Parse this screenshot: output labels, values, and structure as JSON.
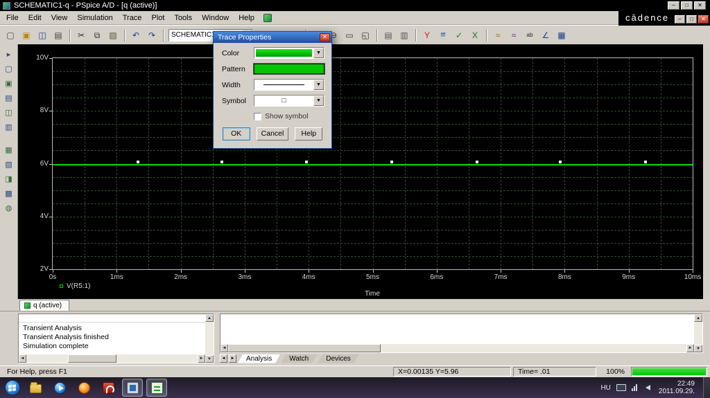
{
  "window": {
    "title": "SCHEMATIC1-q - PSpice A/D - [q (active)]",
    "brand": "cādence",
    "controls": {
      "minimize": "–",
      "maximize": "□",
      "close": "✕"
    }
  },
  "ui": {
    "dropdown_arrow": "▼",
    "up_arrow": "▲",
    "down_arrow": "▼",
    "left_arrow": "◄",
    "right_arrow": "►"
  },
  "menu": {
    "items": [
      "File",
      "Edit",
      "View",
      "Simulation",
      "Trace",
      "Plot",
      "Tools",
      "Window",
      "Help"
    ]
  },
  "toolbar": {
    "profile_value": "SCHEMATIC1-q",
    "icons": [
      {
        "name": "new-file",
        "glyph": "▢",
        "color": "#444444"
      },
      {
        "name": "open-file",
        "glyph": "▣",
        "color": "#b8860b"
      },
      {
        "name": "save-file",
        "glyph": "◫",
        "color": "#1d3f8f"
      },
      {
        "name": "print",
        "glyph": "▤",
        "color": "#444444"
      },
      {
        "sep": true
      },
      {
        "name": "cut",
        "glyph": "✂",
        "color": "#333333"
      },
      {
        "name": "copy",
        "glyph": "⧉",
        "color": "#333333"
      },
      {
        "name": "paste",
        "glyph": "▨",
        "color": "#555533"
      },
      {
        "sep": true
      },
      {
        "name": "undo",
        "glyph": "↶",
        "color": "#1d3f8f"
      },
      {
        "name": "redo",
        "glyph": "↷",
        "color": "#1d3f8f"
      },
      {
        "sep": true
      },
      {
        "combo": true
      },
      {
        "name": "run-simulation",
        "glyph": "▶",
        "color": "#1d6fbf"
      },
      {
        "name": "pause-simulation",
        "glyph": "‖",
        "color": "#222222"
      },
      {
        "name": "stop-simulation",
        "glyph": "■",
        "color": "#aa2222"
      },
      {
        "sep": true
      },
      {
        "name": "zoom-in",
        "glyph": "⊕",
        "color": "#333333"
      },
      {
        "name": "zoom-out",
        "glyph": "⊖",
        "color": "#333333"
      },
      {
        "name": "zoom-area",
        "glyph": "▭",
        "color": "#333333"
      },
      {
        "name": "zoom-fit",
        "glyph": "◱",
        "color": "#333333"
      },
      {
        "sep": true
      },
      {
        "name": "log-x-axis",
        "glyph": "▤",
        "color": "#555555"
      },
      {
        "name": "log-y-axis",
        "glyph": "▥",
        "color": "#555555"
      },
      {
        "sep": true
      },
      {
        "name": "toggle-cursor",
        "glyph": "Y",
        "color": "#c02020"
      },
      {
        "name": "fourier",
        "glyph": "fff",
        "color": "#1d3f8f",
        "small": true
      },
      {
        "name": "evaluate-measurement",
        "glyph": "✓",
        "color": "#0a8a0a"
      },
      {
        "name": "export-to-excel",
        "glyph": "X",
        "color": "#0a7a2a"
      },
      {
        "sep": true
      },
      {
        "name": "mark-data-points",
        "glyph": "≈",
        "color": "#a06000"
      },
      {
        "name": "performance-analysis",
        "glyph": "≈",
        "color": "#6020a0"
      },
      {
        "name": "text-label",
        "glyph": "ab",
        "color": "#222222",
        "small": true
      },
      {
        "name": "plot-waveform",
        "glyph": "∠",
        "color": "#1d3f8f"
      },
      {
        "name": "copy-to-clipboard",
        "glyph": "▦",
        "color": "#1d3f8f"
      }
    ]
  },
  "sidebar": {
    "icons": [
      {
        "name": "sidebar-tool-1",
        "glyph": "▸",
        "color": "#2a4a7a"
      },
      {
        "name": "sidebar-tool-2",
        "glyph": "▢",
        "color": "#2a4a7a"
      },
      {
        "name": "sidebar-tool-3",
        "glyph": "▣",
        "color": "#3a6a3a"
      },
      {
        "name": "sidebar-tool-4",
        "glyph": "▤",
        "color": "#2a4a7a"
      },
      {
        "name": "sidebar-tool-5",
        "glyph": "◫",
        "color": "#3a6a3a"
      },
      {
        "name": "sidebar-tool-6",
        "glyph": "▥",
        "color": "#2a4a7a"
      },
      {
        "gap": true
      },
      {
        "name": "sidebar-tool-7",
        "glyph": "▦",
        "color": "#3a6a3a"
      },
      {
        "name": "sidebar-tool-8",
        "glyph": "▧",
        "color": "#2a4a7a"
      },
      {
        "name": "sidebar-tool-9",
        "glyph": "◨",
        "color": "#3a6a3a"
      },
      {
        "name": "sidebar-tool-10",
        "glyph": "▩",
        "color": "#2a4a7a"
      },
      {
        "name": "sidebar-tool-11",
        "glyph": "◍",
        "color": "#3a6a3a"
      }
    ]
  },
  "chart_data": {
    "type": "line",
    "title": "",
    "xlabel": "Time",
    "ylabel": "",
    "xlim": [
      0,
      10
    ],
    "ylim": [
      2,
      10
    ],
    "x_unit": "ms",
    "grid": true,
    "grid_step_x": 0.5,
    "grid_step_y": 0.5,
    "x_ticks": [
      {
        "v": 0,
        "label": "0s"
      },
      {
        "v": 1,
        "label": "1ms"
      },
      {
        "v": 2,
        "label": "2ms"
      },
      {
        "v": 3,
        "label": "3ms"
      },
      {
        "v": 4,
        "label": "4ms"
      },
      {
        "v": 5,
        "label": "5ms"
      },
      {
        "v": 6,
        "label": "6ms"
      },
      {
        "v": 7,
        "label": "7ms"
      },
      {
        "v": 8,
        "label": "8ms"
      },
      {
        "v": 9,
        "label": "9ms"
      },
      {
        "v": 10,
        "label": "10ms"
      }
    ],
    "y_ticks": [
      {
        "v": 2,
        "label": "2V"
      },
      {
        "v": 4,
        "label": "4V"
      },
      {
        "v": 6,
        "label": "6V"
      },
      {
        "v": 8,
        "label": "8V"
      },
      {
        "v": 10,
        "label": "10V"
      }
    ],
    "series": [
      {
        "name": "V(R5:1)",
        "color": "#00d800",
        "shape": "constant",
        "value": 5.95,
        "marker_x": [
          1.33,
          2.64,
          3.97,
          5.3,
          6.63,
          7.93,
          9.26
        ]
      }
    ],
    "legend_position": "bottom-left",
    "background": "#000000"
  },
  "plot_tab": {
    "label": "q (active)"
  },
  "output": {
    "lines": [
      "Transient Analysis",
      "Transient Analysis finished",
      "Simulation complete"
    ]
  },
  "watch": {
    "tabs": [
      "Analysis",
      "Watch",
      "Devices"
    ],
    "active": "Analysis"
  },
  "status": {
    "help": "For Help, press F1",
    "coords": "X=0.00135  Y=5.96",
    "time": "Time= .01",
    "progress_label": "100%",
    "progress_value": 100,
    "progress_color": "#00c800"
  },
  "taskbar": {
    "language": "HU",
    "clock": "22:49",
    "date": "2011.09.29.",
    "apps": [
      {
        "name": "start-button",
        "icon": "start"
      },
      {
        "name": "windows-explorer",
        "icon": "folder"
      },
      {
        "name": "media-player",
        "icon": "media"
      },
      {
        "name": "firefox",
        "icon": "firefox"
      },
      {
        "name": "adobe-reader",
        "icon": "reader"
      },
      {
        "name": "screen-capture-app",
        "icon": "capture",
        "active": true
      },
      {
        "name": "pspice-app",
        "icon": "pspice",
        "active": true
      }
    ]
  },
  "dialog": {
    "title": "Trace Properties",
    "close_glyph": "✕",
    "fields": {
      "color": "Color",
      "pattern": "Pattern",
      "width": "Width",
      "symbol": "Symbol",
      "symbol_value": "□"
    },
    "checkbox_label": "Show symbol",
    "buttons": {
      "ok": "OK",
      "cancel": "Cancel",
      "help": "Help"
    },
    "trace_color": "#00cc00"
  }
}
